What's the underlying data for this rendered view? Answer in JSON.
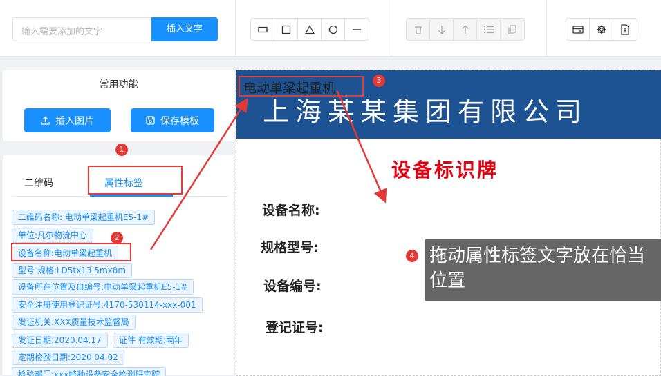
{
  "toolbar": {
    "text_input_placeholder": "输入需要添加的文字",
    "insert_text_label": "插入文字",
    "shape_icons": [
      "rect-wide-icon",
      "square-icon",
      "triangle-icon",
      "circle-icon",
      "line-icon"
    ],
    "arrange_icons": [
      "trash-icon",
      "arrow-down-icon",
      "arrow-up-icon",
      "list-icon",
      "copy-icon"
    ],
    "misc_icons": [
      "card-icon",
      "gear-icon",
      "export-pdf-icon"
    ]
  },
  "sidebar": {
    "common_title": "常用功能",
    "insert_image_label": "插入图片",
    "save_template_label": "保存模板",
    "tabs": [
      {
        "label": "二维码",
        "active": false
      },
      {
        "label": "属性标签",
        "active": true
      }
    ],
    "tags": [
      "二维码名称: 电动单梁起重机E5-1#",
      "单位:凡尔物流中心",
      "设备名称:电动单梁起重机",
      "型号 规格:LD5tx13.5mx8m",
      "设备所在位置及自编号:电动单梁起重机E5-1#",
      "安全注册使用登记证号:4170-530114-xxx-001",
      "发证机关:XXX质量技术监督局",
      "发证日期:2020.04.17",
      "证件 有效期:两年",
      "定期检验日期:2020.04.02",
      "检验部门:xxx特种设备安全检测研究院"
    ]
  },
  "canvas": {
    "company_name": "上海某某集团有限公司",
    "sign_title": "设备标识牌",
    "fields": [
      "设备名称:",
      "规格型号:",
      "设备编号:",
      "登记证号:"
    ],
    "dragged_label": "电动单梁起重机",
    "banner_color": "#1d5393",
    "title_color": "#e60012"
  },
  "annotations": {
    "markers": [
      "1",
      "2",
      "3",
      "4"
    ],
    "tip_text": "拖动属性标签文字放在恰当位置",
    "color": "#e53935"
  }
}
